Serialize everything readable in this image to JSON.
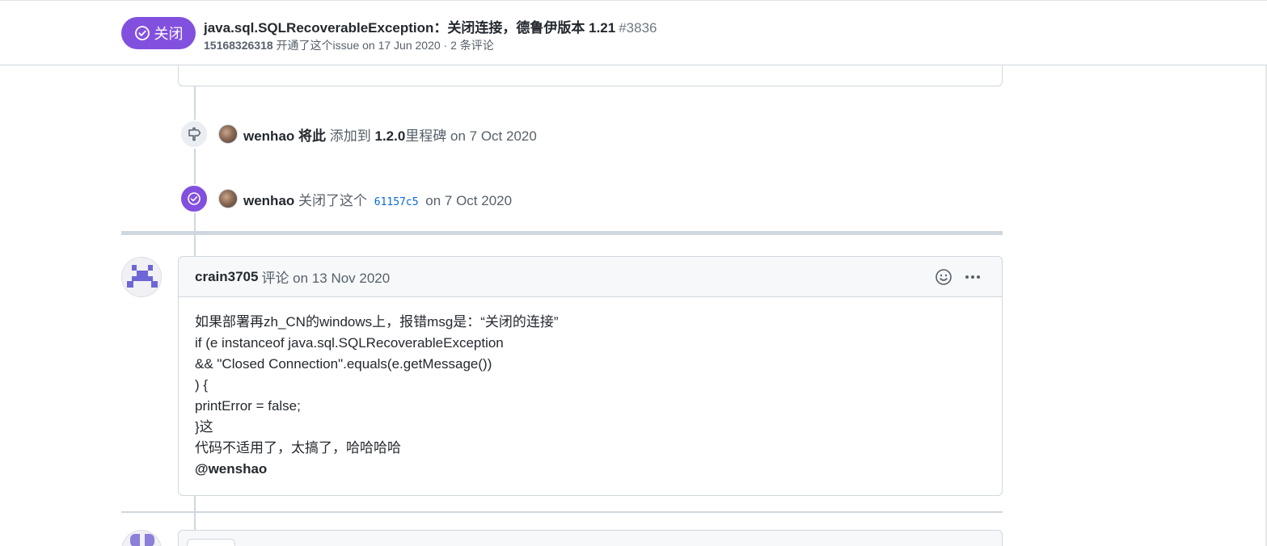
{
  "header": {
    "state_label": "关闭",
    "title": "java.sql.SQLRecoverableException：关闭连接，德鲁伊版本 1.21",
    "issue_number": "#3836",
    "author": "15168326318",
    "meta_text": " 开通了这个issue on 17 Jun 2020 · 2 条评论"
  },
  "timeline": {
    "milestone_event": {
      "icon": "milestone-icon",
      "actor": "wenhao",
      "verb": "将此",
      "action": " 添加到 ",
      "milestone": "1.2.0",
      "suffix": "里程碑",
      "date": " on 7 Oct 2020"
    },
    "closed_event": {
      "icon": "check-circle-icon",
      "actor": "wenhao",
      "action": " 关闭了这个 ",
      "commit": "61157c5",
      "date": " on 7 Oct 2020"
    }
  },
  "comment": {
    "author": "crain3705",
    "meta": "评论 on 13 Nov 2020",
    "icons": [
      "smiley-icon",
      "kebab-horizontal-icon"
    ],
    "lines": [
      "如果部署再zh_CN的windows上，报错msg是：“关闭的连接”",
      "if (e instanceof java.sql.SQLRecoverableException",
      "&& \"Closed Connection\".equals(e.getMessage())",
      ") {",
      "printError = false;",
      "}这",
      "代码不适用了，太搞了，哈哈哈哈",
      "@wenshao"
    ]
  },
  "colors": {
    "closed_purple": "#8250df",
    "border": "#d0d7de",
    "header_bg": "#f6f8fa",
    "link_blue": "#0969da"
  }
}
